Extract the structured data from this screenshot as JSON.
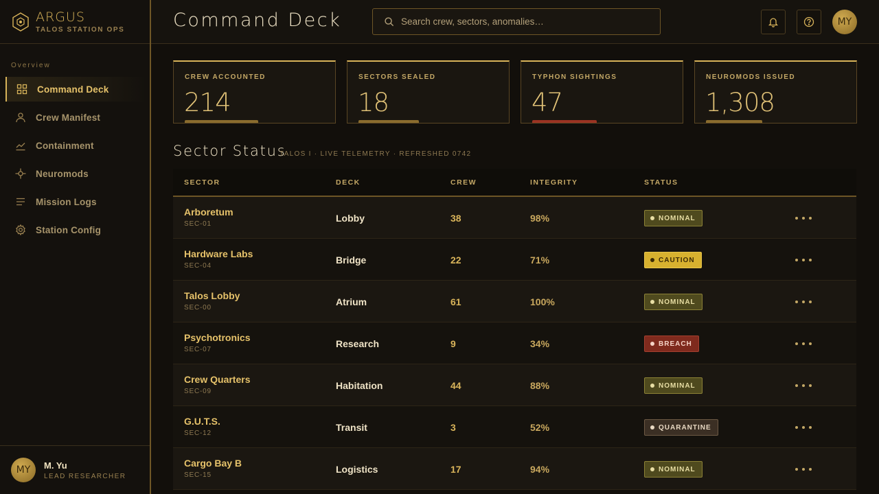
{
  "brand": {
    "name": "ARGUS",
    "subtitle": "TALOS STATION OPS"
  },
  "sidebar": {
    "section": "Overview",
    "items": [
      {
        "label": "Command Deck",
        "icon": "grid-icon",
        "active": true
      },
      {
        "label": "Crew Manifest",
        "icon": "user-icon",
        "active": false
      },
      {
        "label": "Containment",
        "icon": "chart-line-icon",
        "active": false
      },
      {
        "label": "Neuromods",
        "icon": "crosshair-icon",
        "active": false
      },
      {
        "label": "Mission Logs",
        "icon": "list-icon",
        "active": false
      },
      {
        "label": "Station Config",
        "icon": "gear-icon",
        "active": false
      }
    ],
    "user": {
      "initials": "MY",
      "name": "M. Yu",
      "role": "LEAD RESEARCHER"
    }
  },
  "header": {
    "title": "Command Deck",
    "search_placeholder": "Search crew, sectors, anomalies…",
    "avatar_initials": "MY"
  },
  "stats": [
    {
      "label": "CREW ACCOUNTED",
      "value": "214",
      "fill": 0.52,
      "tone": "normal"
    },
    {
      "label": "SECTORS SEALED",
      "value": "18",
      "fill": 0.43,
      "tone": "normal"
    },
    {
      "label": "TYPHON SIGHTINGS",
      "value": "47",
      "fill": 0.46,
      "tone": "danger"
    },
    {
      "label": "NEUROMODS ISSUED",
      "value": "1,308",
      "fill": 0.4,
      "tone": "normal"
    }
  ],
  "section": {
    "title": "Sector Status",
    "subtitle": "TALOS I · LIVE TELEMETRY · REFRESHED 0742"
  },
  "table": {
    "columns": [
      "SECTOR",
      "DECK",
      "CREW",
      "INTEGRITY",
      "STATUS"
    ],
    "rows": [
      {
        "name": "Arboretum",
        "code": "SEC-01",
        "deck": "Lobby",
        "crew": "38",
        "integrity": "98%",
        "status": "NOMINAL",
        "tone": "nominal"
      },
      {
        "name": "Hardware Labs",
        "code": "SEC-04",
        "deck": "Bridge",
        "crew": "22",
        "integrity": "71%",
        "status": "CAUTION",
        "tone": "caution"
      },
      {
        "name": "Talos Lobby",
        "code": "SEC-00",
        "deck": "Atrium",
        "crew": "61",
        "integrity": "100%",
        "status": "NOMINAL",
        "tone": "nominal"
      },
      {
        "name": "Psychotronics",
        "code": "SEC-07",
        "deck": "Research",
        "crew": "9",
        "integrity": "34%",
        "status": "BREACH",
        "tone": "breach"
      },
      {
        "name": "Crew Quarters",
        "code": "SEC-09",
        "deck": "Habitation",
        "crew": "44",
        "integrity": "88%",
        "status": "NOMINAL",
        "tone": "nominal"
      },
      {
        "name": "G.U.T.S.",
        "code": "SEC-12",
        "deck": "Transit",
        "crew": "3",
        "integrity": "52%",
        "status": "QUARANTINE",
        "tone": "quarantine"
      },
      {
        "name": "Cargo Bay B",
        "code": "SEC-15",
        "deck": "Logistics",
        "crew": "17",
        "integrity": "94%",
        "status": "NOMINAL",
        "tone": "nominal"
      }
    ]
  },
  "colors": {
    "accent": "#d9b45a",
    "breach": "#7f2a1d",
    "caution": "#d7b12f",
    "nominal": "#4f4a1e"
  }
}
